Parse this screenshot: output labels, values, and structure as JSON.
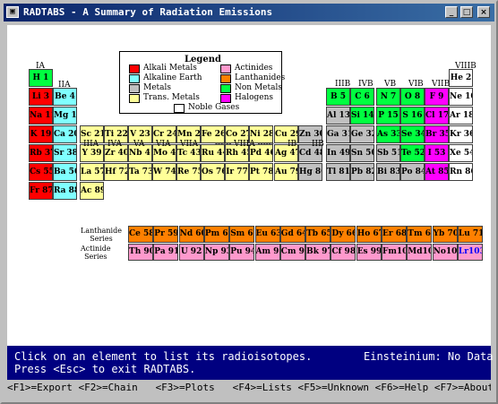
{
  "window": {
    "title": "RADTABS - A Summary of Radiation Emissions",
    "icon": "app-icon",
    "minimize": "_",
    "maximize": "□",
    "close": "×"
  },
  "colors": {
    "alkali": "#ff0000",
    "alkaline": "#80ffff",
    "metals": "#c0c0c0",
    "trans": "#ffff99",
    "actinides": "#ff99cc",
    "lanthanides": "#ff8000",
    "nonmetals": "#00ff40",
    "halogens": "#ff00ff",
    "noble": "#ffffff",
    "message_bg": "#000080"
  },
  "legend": {
    "title": "Legend",
    "items": [
      {
        "label": "Alkali Metals",
        "cat": "alkali"
      },
      {
        "label": "Actinides",
        "cat": "actinides"
      },
      {
        "label": "Alkaline Earth",
        "cat": "alkaline"
      },
      {
        "label": "Lanthanides",
        "cat": "lanthanides"
      },
      {
        "label": "Metals",
        "cat": "metals"
      },
      {
        "label": "Non Metals",
        "cat": "nonmetals"
      },
      {
        "label": "Trans. Metals",
        "cat": "trans"
      },
      {
        "label": "Halogens",
        "cat": "halogens"
      },
      {
        "label": "Noble Gases",
        "cat": "noble"
      }
    ]
  },
  "groups": [
    "IA",
    "IIA",
    "IIIA",
    "IVA",
    "VA",
    "VIA",
    "VIIA",
    "------ VIIIA ------",
    "IB",
    "IIB",
    "IIIB",
    "IVB",
    "VB",
    "VIB",
    "VIIB",
    "VIIIB"
  ],
  "series_labels": {
    "lanthanide": "Lanthanide\nSeries",
    "actinide": "Actinide\nSeries"
  },
  "elements": [
    {
      "text": "H 1",
      "cat": "nonmetals",
      "row": 1,
      "col": 1
    },
    {
      "text": "He 2",
      "cat": "noble",
      "row": 1,
      "col": 18
    },
    {
      "text": "Li 3",
      "cat": "alkali",
      "row": 2,
      "col": 1
    },
    {
      "text": "Be 4",
      "cat": "alkaline",
      "row": 2,
      "col": 2
    },
    {
      "text": "B 5",
      "cat": "nonmetals",
      "row": 2,
      "col": 13
    },
    {
      "text": "C 6",
      "cat": "nonmetals",
      "row": 2,
      "col": 14
    },
    {
      "text": "N 7",
      "cat": "nonmetals",
      "row": 2,
      "col": 15
    },
    {
      "text": "O 8",
      "cat": "nonmetals",
      "row": 2,
      "col": 16
    },
    {
      "text": "F 9",
      "cat": "halogens",
      "row": 2,
      "col": 17
    },
    {
      "text": "Ne 10",
      "cat": "noble",
      "row": 2,
      "col": 18
    },
    {
      "text": "Na 11",
      "cat": "alkali",
      "row": 3,
      "col": 1
    },
    {
      "text": "Mg 12",
      "cat": "alkaline",
      "row": 3,
      "col": 2
    },
    {
      "text": "Al 13",
      "cat": "metals",
      "row": 3,
      "col": 13
    },
    {
      "text": "Si 14",
      "cat": "nonmetals",
      "row": 3,
      "col": 14
    },
    {
      "text": "P 15",
      "cat": "nonmetals",
      "row": 3,
      "col": 15
    },
    {
      "text": "S 16",
      "cat": "nonmetals",
      "row": 3,
      "col": 16
    },
    {
      "text": "Cl 17",
      "cat": "halogens",
      "row": 3,
      "col": 17
    },
    {
      "text": "Ar 18",
      "cat": "noble",
      "row": 3,
      "col": 18
    },
    {
      "text": "K 19",
      "cat": "alkali",
      "row": 4,
      "col": 1
    },
    {
      "text": "Ca 20",
      "cat": "alkaline",
      "row": 4,
      "col": 2
    },
    {
      "text": "Sc 21",
      "cat": "trans",
      "row": 4,
      "col": 3
    },
    {
      "text": "Ti 22",
      "cat": "trans",
      "row": 4,
      "col": 4
    },
    {
      "text": "V 23",
      "cat": "trans",
      "row": 4,
      "col": 5
    },
    {
      "text": "Cr 24",
      "cat": "trans",
      "row": 4,
      "col": 6
    },
    {
      "text": "Mn 25",
      "cat": "trans",
      "row": 4,
      "col": 7
    },
    {
      "text": "Fe 26",
      "cat": "trans",
      "row": 4,
      "col": 8
    },
    {
      "text": "Co 27",
      "cat": "trans",
      "row": 4,
      "col": 9
    },
    {
      "text": "Ni 28",
      "cat": "trans",
      "row": 4,
      "col": 10
    },
    {
      "text": "Cu 29",
      "cat": "trans",
      "row": 4,
      "col": 11
    },
    {
      "text": "Zn 30",
      "cat": "metals",
      "row": 4,
      "col": 12
    },
    {
      "text": "Ga 31",
      "cat": "metals",
      "row": 4,
      "col": 13
    },
    {
      "text": "Ge 32",
      "cat": "metals",
      "row": 4,
      "col": 14
    },
    {
      "text": "As 33",
      "cat": "nonmetals",
      "row": 4,
      "col": 15
    },
    {
      "text": "Se 34",
      "cat": "nonmetals",
      "row": 4,
      "col": 16
    },
    {
      "text": "Br 35",
      "cat": "halogens",
      "row": 4,
      "col": 17
    },
    {
      "text": "Kr 36",
      "cat": "noble",
      "row": 4,
      "col": 18
    },
    {
      "text": "Rb 37",
      "cat": "alkali",
      "row": 5,
      "col": 1
    },
    {
      "text": "Sr 38",
      "cat": "alkaline",
      "row": 5,
      "col": 2
    },
    {
      "text": "Y 39",
      "cat": "trans",
      "row": 5,
      "col": 3
    },
    {
      "text": "Zr 40",
      "cat": "trans",
      "row": 5,
      "col": 4
    },
    {
      "text": "Nb 41",
      "cat": "trans",
      "row": 5,
      "col": 5
    },
    {
      "text": "Mo 42",
      "cat": "trans",
      "row": 5,
      "col": 6
    },
    {
      "text": "Tc 43",
      "cat": "trans",
      "row": 5,
      "col": 7
    },
    {
      "text": "Ru 44",
      "cat": "trans",
      "row": 5,
      "col": 8
    },
    {
      "text": "Rh 45",
      "cat": "trans",
      "row": 5,
      "col": 9
    },
    {
      "text": "Pd 46",
      "cat": "trans",
      "row": 5,
      "col": 10
    },
    {
      "text": "Ag 47",
      "cat": "trans",
      "row": 5,
      "col": 11
    },
    {
      "text": "Cd 48",
      "cat": "metals",
      "row": 5,
      "col": 12
    },
    {
      "text": "In 49",
      "cat": "metals",
      "row": 5,
      "col": 13
    },
    {
      "text": "Sn 50",
      "cat": "metals",
      "row": 5,
      "col": 14
    },
    {
      "text": "Sb 51",
      "cat": "metals",
      "row": 5,
      "col": 15
    },
    {
      "text": "Te 52",
      "cat": "nonmetals",
      "row": 5,
      "col": 16
    },
    {
      "text": "I 53",
      "cat": "halogens",
      "row": 5,
      "col": 17
    },
    {
      "text": "Xe 54",
      "cat": "noble",
      "row": 5,
      "col": 18
    },
    {
      "text": "Cs 55",
      "cat": "alkali",
      "row": 6,
      "col": 1
    },
    {
      "text": "Ba 56",
      "cat": "alkaline",
      "row": 6,
      "col": 2
    },
    {
      "text": "La 57",
      "cat": "trans",
      "row": 6,
      "col": 3
    },
    {
      "text": "Hf 72",
      "cat": "trans",
      "row": 6,
      "col": 4
    },
    {
      "text": "Ta 73",
      "cat": "trans",
      "row": 6,
      "col": 5
    },
    {
      "text": "W 74",
      "cat": "trans",
      "row": 6,
      "col": 6
    },
    {
      "text": "Re 75",
      "cat": "trans",
      "row": 6,
      "col": 7
    },
    {
      "text": "Os 76",
      "cat": "trans",
      "row": 6,
      "col": 8
    },
    {
      "text": "Ir 77",
      "cat": "trans",
      "row": 6,
      "col": 9
    },
    {
      "text": "Pt 78",
      "cat": "trans",
      "row": 6,
      "col": 10
    },
    {
      "text": "Au 79",
      "cat": "trans",
      "row": 6,
      "col": 11
    },
    {
      "text": "Hg 80",
      "cat": "metals",
      "row": 6,
      "col": 12
    },
    {
      "text": "Tl 81",
      "cat": "metals",
      "row": 6,
      "col": 13
    },
    {
      "text": "Pb 82",
      "cat": "metals",
      "row": 6,
      "col": 14
    },
    {
      "text": "Bi 83",
      "cat": "metals",
      "row": 6,
      "col": 15
    },
    {
      "text": "Po 84",
      "cat": "metals",
      "row": 6,
      "col": 16
    },
    {
      "text": "At 85",
      "cat": "halogens",
      "row": 6,
      "col": 17
    },
    {
      "text": "Rn 86",
      "cat": "noble",
      "row": 6,
      "col": 18
    },
    {
      "text": "Fr 87",
      "cat": "alkali",
      "row": 7,
      "col": 1
    },
    {
      "text": "Ra 88",
      "cat": "alkaline",
      "row": 7,
      "col": 2
    },
    {
      "text": "Ac 89",
      "cat": "trans",
      "row": 7,
      "col": 3
    }
  ],
  "lanthanides": [
    "Ce 58",
    "Pr 59",
    "Nd 60",
    "Pm 61",
    "Sm 62",
    "Eu 63",
    "Gd 64",
    "Tb 65",
    "Dy 66",
    "Ho 67",
    "Er 68",
    "Tm 69",
    "Yb 70",
    "Lu 71"
  ],
  "actinides": [
    "Th 90",
    "Pa 91",
    "U 92",
    "Np 93",
    "Pu 94",
    "Am 95",
    "Cm 96",
    "Bk 97",
    "Cf 98",
    "Es 99",
    "Fm100",
    "Md101",
    "No102",
    "Lr103"
  ],
  "selected_element": "Lr103",
  "message": {
    "line1": "Click on an element to list its radioisotopes.",
    "line2": "Press <Esc> to exit RADTABS.",
    "status": "Einsteinium: No Data"
  },
  "function_keys": "<F1>=Export <F2>=Chain   <F3>=Plots   <F4>=Lists <F5>=Unknown <F6>=Help <F7>=About"
}
